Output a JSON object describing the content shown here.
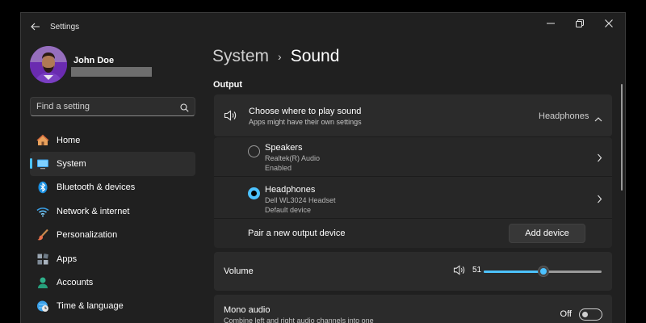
{
  "window": {
    "title": "Settings"
  },
  "profile": {
    "name": "John Doe"
  },
  "search": {
    "placeholder": "Find a setting"
  },
  "sidebar": {
    "items": [
      {
        "label": "Home",
        "icon": "home-icon",
        "active": false
      },
      {
        "label": "System",
        "icon": "system-icon",
        "active": true
      },
      {
        "label": "Bluetooth & devices",
        "icon": "bluetooth-icon",
        "active": false
      },
      {
        "label": "Network & internet",
        "icon": "wifi-icon",
        "active": false
      },
      {
        "label": "Personalization",
        "icon": "brush-icon",
        "active": false
      },
      {
        "label": "Apps",
        "icon": "apps-icon",
        "active": false
      },
      {
        "label": "Accounts",
        "icon": "account-icon",
        "active": false
      },
      {
        "label": "Time & language",
        "icon": "globe-clock-icon",
        "active": false
      }
    ]
  },
  "breadcrumb": {
    "parent": "System",
    "separator": "›",
    "current": "Sound"
  },
  "output": {
    "section_title": "Output",
    "header": {
      "title": "Choose where to play sound",
      "subtitle": "Apps might have their own settings",
      "selected": "Headphones"
    },
    "devices": [
      {
        "name": "Speakers",
        "detail": "Realtek(R) Audio",
        "status": "Enabled",
        "selected": false
      },
      {
        "name": "Headphones",
        "detail": "Dell WL3024 Headset",
        "status": "Default device",
        "selected": true
      }
    ],
    "pair": {
      "label": "Pair a new output device",
      "button": "Add device"
    }
  },
  "volume": {
    "label": "Volume",
    "value": 51
  },
  "mono_audio": {
    "title": "Mono audio",
    "subtitle": "Combine left and right audio channels into one",
    "state": "Off"
  },
  "colors": {
    "accent": "#4cc2ff",
    "background": "#202020",
    "card": "#2b2b2b"
  }
}
